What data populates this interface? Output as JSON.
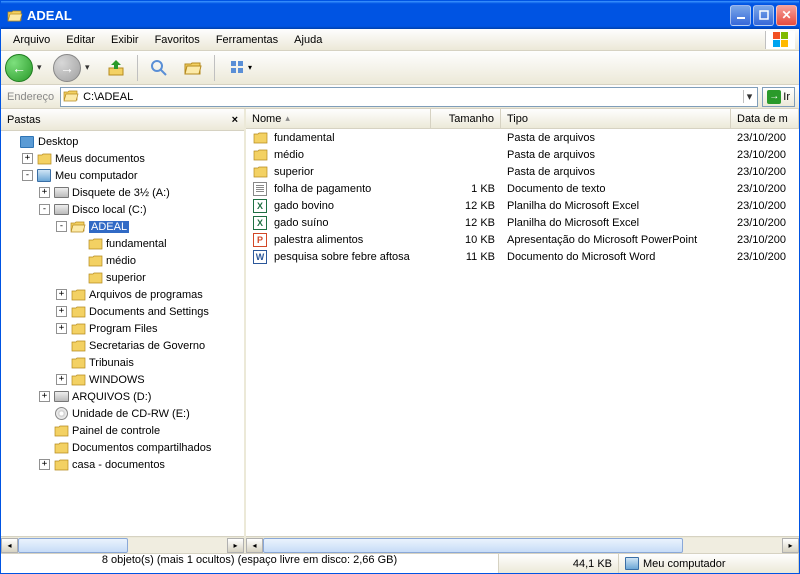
{
  "title": "ADEAL",
  "menu": [
    "Arquivo",
    "Editar",
    "Exibir",
    "Favoritos",
    "Ferramentas",
    "Ajuda"
  ],
  "address": {
    "label": "Endereço",
    "path": "C:\\ADEAL",
    "go": "Ir"
  },
  "sidebar": {
    "title": "Pastas"
  },
  "tree": [
    {
      "ind": 0,
      "exp": "",
      "ico": "desk",
      "label": "Desktop"
    },
    {
      "ind": 1,
      "exp": "+",
      "ico": "folder",
      "label": "Meus documentos"
    },
    {
      "ind": 1,
      "exp": "-",
      "ico": "comp",
      "label": "Meu computador"
    },
    {
      "ind": 2,
      "exp": "+",
      "ico": "drive",
      "label": "Disquete de 3½ (A:)"
    },
    {
      "ind": 2,
      "exp": "-",
      "ico": "drive",
      "label": "Disco local (C:)"
    },
    {
      "ind": 3,
      "exp": "-",
      "ico": "folder-open",
      "label": "ADEAL",
      "sel": true
    },
    {
      "ind": 4,
      "exp": "",
      "ico": "folder",
      "label": "fundamental"
    },
    {
      "ind": 4,
      "exp": "",
      "ico": "folder",
      "label": "médio"
    },
    {
      "ind": 4,
      "exp": "",
      "ico": "folder",
      "label": "superior"
    },
    {
      "ind": 3,
      "exp": "+",
      "ico": "folder",
      "label": "Arquivos de programas"
    },
    {
      "ind": 3,
      "exp": "+",
      "ico": "folder",
      "label": "Documents and Settings"
    },
    {
      "ind": 3,
      "exp": "+",
      "ico": "folder",
      "label": "Program Files"
    },
    {
      "ind": 3,
      "exp": "",
      "ico": "folder",
      "label": "Secretarias de Governo"
    },
    {
      "ind": 3,
      "exp": "",
      "ico": "folder",
      "label": "Tribunais"
    },
    {
      "ind": 3,
      "exp": "+",
      "ico": "folder",
      "label": "WINDOWS"
    },
    {
      "ind": 2,
      "exp": "+",
      "ico": "drive",
      "label": "ARQUIVOS (D:)"
    },
    {
      "ind": 2,
      "exp": "",
      "ico": "cd",
      "label": "Unidade de CD-RW (E:)"
    },
    {
      "ind": 2,
      "exp": "",
      "ico": "folder",
      "label": "Painel de controle"
    },
    {
      "ind": 2,
      "exp": "",
      "ico": "folder",
      "label": "Documentos compartilhados"
    },
    {
      "ind": 2,
      "exp": "+",
      "ico": "folder",
      "label": "casa - documentos"
    }
  ],
  "columns": {
    "name": "Nome",
    "size": "Tamanho",
    "tipo": "Tipo",
    "date": "Data de m"
  },
  "files": [
    {
      "ico": "folder",
      "name": "fundamental",
      "size": "",
      "tipo": "Pasta de arquivos",
      "date": "23/10/200"
    },
    {
      "ico": "folder",
      "name": "médio",
      "size": "",
      "tipo": "Pasta de arquivos",
      "date": "23/10/200"
    },
    {
      "ico": "folder",
      "name": "superior",
      "size": "",
      "tipo": "Pasta de arquivos",
      "date": "23/10/200"
    },
    {
      "ico": "txt",
      "name": "folha de pagamento",
      "size": "1 KB",
      "tipo": "Documento de texto",
      "date": "23/10/200"
    },
    {
      "ico": "xls",
      "name": "gado bovino",
      "size": "12 KB",
      "tipo": "Planilha do Microsoft Excel",
      "date": "23/10/200"
    },
    {
      "ico": "xls",
      "name": "gado suíno",
      "size": "12 KB",
      "tipo": "Planilha do Microsoft Excel",
      "date": "23/10/200"
    },
    {
      "ico": "ppt",
      "name": "palestra alimentos",
      "size": "10 KB",
      "tipo": "Apresentação do Microsoft PowerPoint",
      "date": "23/10/200"
    },
    {
      "ico": "doc",
      "name": "pesquisa sobre febre aftosa",
      "size": "11 KB",
      "tipo": "Documento do Microsoft Word",
      "date": "23/10/200"
    }
  ],
  "status": {
    "main": "8 objeto(s) (mais 1 ocultos) (espaço livre em disco: 2,66 GB)",
    "size": "44,1 KB",
    "loc": "Meu computador"
  }
}
